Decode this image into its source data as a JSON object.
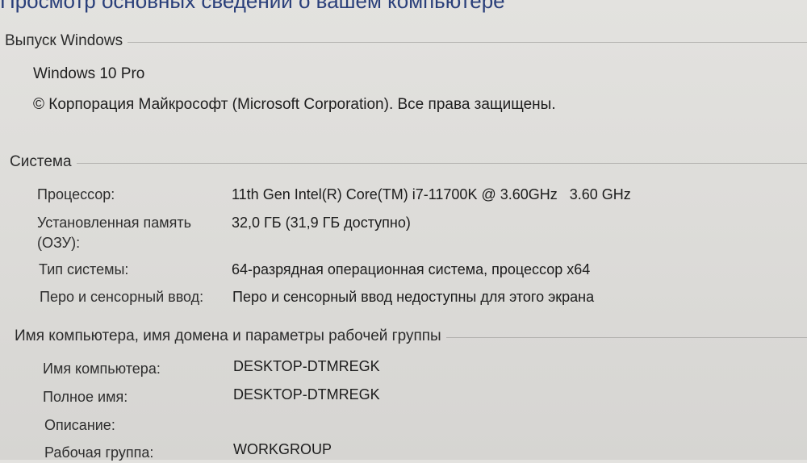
{
  "title": "Просмотр основных сведений о вашем компьютере",
  "edition": {
    "header": "Выпуск Windows",
    "name": "Windows 10 Pro",
    "copyright": "© Корпорация Майкрософт (Microsoft Corporation). Все права защищены."
  },
  "system": {
    "header": "Система",
    "rows": [
      {
        "label": "Процессор:",
        "value": "11th Gen Intel(R) Core(TM) i7-11700K @ 3.60GHz   3.60 GHz"
      },
      {
        "label_line1": "Установленная память",
        "label_line2": "(ОЗУ):",
        "value": "32,0 ГБ (31,9 ГБ доступно)"
      },
      {
        "label": "Тип системы:",
        "value": "64-разрядная операционная система, процессор x64"
      },
      {
        "label": "Перо и сенсорный ввод:",
        "value": "Перо и сенсорный ввод недоступны для этого экрана"
      }
    ]
  },
  "computer": {
    "header": "Имя компьютера, имя домена и параметры рабочей группы",
    "rows": [
      {
        "label": "Имя компьютера:",
        "value": "DESKTOP-DTMREGK"
      },
      {
        "label": "Полное имя:",
        "value": "DESKTOP-DTMREGK"
      },
      {
        "label": "Описание:",
        "value": ""
      },
      {
        "label": "Рабочая группа:",
        "value": "WORKGROUP"
      }
    ]
  }
}
